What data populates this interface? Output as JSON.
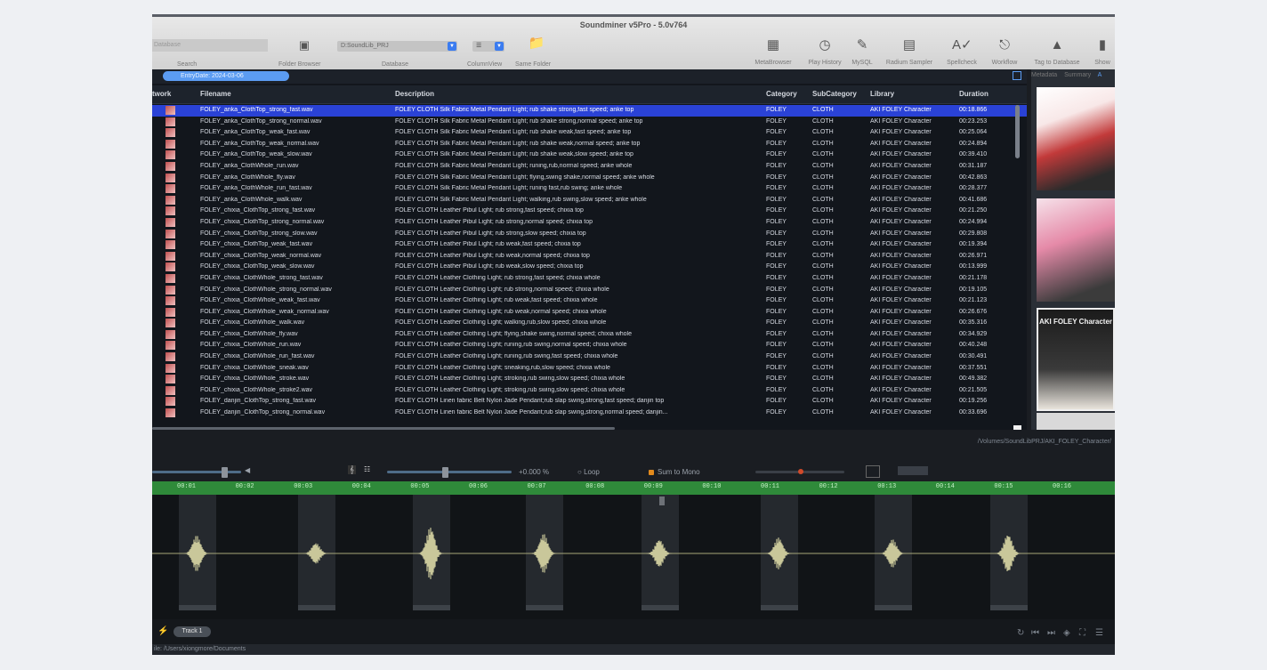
{
  "window": {
    "title": "Soundminer v5Pro - 5.0v764"
  },
  "toolbar": {
    "search_placeholder": "Database",
    "search_label": "Search",
    "folder_browser_label": "Folder Browser",
    "database_value": "D:SoundLib_PRJ",
    "database_label": "Database",
    "columnview_value": "☰",
    "columnview_label": "ColumnView",
    "same_folder_label": "Same Folder",
    "right_items": [
      {
        "label": "MetaBrowser",
        "icon": "metabrowser-icon"
      },
      {
        "label": "Play History",
        "icon": "clock-icon"
      },
      {
        "label": "MySQL",
        "icon": "database-icon"
      },
      {
        "label": "Radium Sampler",
        "icon": "sampler-icon"
      },
      {
        "label": "Spellcheck",
        "icon": "spellcheck-icon"
      },
      {
        "label": "Workflow",
        "icon": "workflow-icon"
      },
      {
        "label": "Tag to Database",
        "icon": "tag-icon"
      },
      {
        "label": "Show",
        "icon": "show-icon"
      }
    ]
  },
  "filter": {
    "pill": "EntryDate: 2024-03-06"
  },
  "table": {
    "headers": [
      "twork",
      "Filename",
      "Description",
      "Category",
      "SubCategory",
      "Library",
      "Duration"
    ],
    "selected_index": 0,
    "rows": [
      [
        "FOLEY_anka_ClothTop_strong_fast.wav",
        "FOLEY CLOTH Silk Fabric Metal Pendant Light; rub shake strong,fast speed; anke top",
        "FOLEY",
        "CLOTH",
        "AKI FOLEY Character",
        "00:18.866"
      ],
      [
        "FOLEY_anka_ClothTop_strong_normal.wav",
        "FOLEY CLOTH Silk Fabric Metal Pendant Light; rub shake strong,normal speed; anke top",
        "FOLEY",
        "CLOTH",
        "AKI FOLEY Character",
        "00:23.253"
      ],
      [
        "FOLEY_anka_ClothTop_weak_fast.wav",
        "FOLEY CLOTH Silk Fabric Metal Pendant Light; rub shake weak,fast speed; anke top",
        "FOLEY",
        "CLOTH",
        "AKI FOLEY Character",
        "00:25.064"
      ],
      [
        "FOLEY_anka_ClothTop_weak_normal.wav",
        "FOLEY CLOTH Silk Fabric Metal Pendant Light; rub shake weak,normal speed; anke top",
        "FOLEY",
        "CLOTH",
        "AKI FOLEY Character",
        "00:24.894"
      ],
      [
        "FOLEY_anka_ClothTop_weak_slow.wav",
        "FOLEY CLOTH Silk Fabric Metal Pendant Light; rub shake weak,slow speed; anke top",
        "FOLEY",
        "CLOTH",
        "AKI FOLEY Character",
        "00:39.410"
      ],
      [
        "FOLEY_anka_ClothWhole_run.wav",
        "FOLEY CLOTH Silk Fabric Metal Pendant Light; runing,rub,normal speed; anke whole",
        "FOLEY",
        "CLOTH",
        "AKI FOLEY Character",
        "00:31.187"
      ],
      [
        "FOLEY_anka_ClothWhole_fly.wav",
        "FOLEY CLOTH Silk Fabric Metal Pendant Light; flying,swing shake,normal speed; anke whole",
        "FOLEY",
        "CLOTH",
        "AKI FOLEY Character",
        "00:42.863"
      ],
      [
        "FOLEY_anka_ClothWhole_run_fast.wav",
        "FOLEY CLOTH Silk Fabric Metal Pendant Light; runing fast,rub swing; anke whole",
        "FOLEY",
        "CLOTH",
        "AKI FOLEY Character",
        "00:28.377"
      ],
      [
        "FOLEY_anka_ClothWhole_walk.wav",
        "FOLEY CLOTH Silk Fabric Metal Pendant Light; walking,rub swing,slow speed; anke whole",
        "FOLEY",
        "CLOTH",
        "AKI FOLEY Character",
        "00:41.686"
      ],
      [
        "FOLEY_chixia_ClothTop_strong_fast.wav",
        "FOLEY CLOTH Leather Pibul Light; rub strong,fast speed; chixia top",
        "FOLEY",
        "CLOTH",
        "AKI FOLEY Character",
        "00:21.250"
      ],
      [
        "FOLEY_chixia_ClothTop_strong_normal.wav",
        "FOLEY CLOTH Leather Pibul Light; rub strong,normal speed; chixia top",
        "FOLEY",
        "CLOTH",
        "AKI FOLEY Character",
        "00:24.994"
      ],
      [
        "FOLEY_chixia_ClothTop_strong_slow.wav",
        "FOLEY CLOTH Leather Pibul Light; rub strong,slow speed; chixia top",
        "FOLEY",
        "CLOTH",
        "AKI FOLEY Character",
        "00:29.808"
      ],
      [
        "FOLEY_chixia_ClothTop_weak_fast.wav",
        "FOLEY CLOTH Leather Pibul Light; rub weak,fast speed; chixia top",
        "FOLEY",
        "CLOTH",
        "AKI FOLEY Character",
        "00:19.394"
      ],
      [
        "FOLEY_chixia_ClothTop_weak_normal.wav",
        "FOLEY CLOTH Leather Pibul Light; rub weak,normal speed; chixia top",
        "FOLEY",
        "CLOTH",
        "AKI FOLEY Character",
        "00:26.971"
      ],
      [
        "FOLEY_chixia_ClothTop_weak_slow.wav",
        "FOLEY CLOTH Leather Pibul Light; rub weak,slow speed; chixia top",
        "FOLEY",
        "CLOTH",
        "AKI FOLEY Character",
        "00:13.999"
      ],
      [
        "FOLEY_chixia_ClothWhole_strong_fast.wav",
        "FOLEY CLOTH Leather Clothing Light; rub strong,fast speed; chixia whole",
        "FOLEY",
        "CLOTH",
        "AKI FOLEY Character",
        "00:21.178"
      ],
      [
        "FOLEY_chixia_ClothWhole_strong_normal.wav",
        "FOLEY CLOTH Leather Clothing Light; rub strong,normal speed; chixia whole",
        "FOLEY",
        "CLOTH",
        "AKI FOLEY Character",
        "00:19.105"
      ],
      [
        "FOLEY_chixia_ClothWhole_weak_fast.wav",
        "FOLEY CLOTH Leather Clothing Light; rub weak,fast speed; chixia whole",
        "FOLEY",
        "CLOTH",
        "AKI FOLEY Character",
        "00:21.123"
      ],
      [
        "FOLEY_chixia_ClothWhole_weak_normal.wav",
        "FOLEY CLOTH Leather Clothing Light; rub weak,normal speed; chixia whole",
        "FOLEY",
        "CLOTH",
        "AKI FOLEY Character",
        "00:26.676"
      ],
      [
        "FOLEY_chixia_ClothWhole_walk.wav",
        "FOLEY CLOTH Leather Clothing Light; walking,rub,slow speed; chixia whole",
        "FOLEY",
        "CLOTH",
        "AKI FOLEY Character",
        "00:35.316"
      ],
      [
        "FOLEY_chixia_ClothWhole_fly.wav",
        "FOLEY CLOTH Leather Clothing Light; flying,shake swing,normal speed; chixia whole",
        "FOLEY",
        "CLOTH",
        "AKI FOLEY Character",
        "00:34.929"
      ],
      [
        "FOLEY_chixia_ClothWhole_run.wav",
        "FOLEY CLOTH Leather Clothing Light; runing,rub swing,normal speed; chixia whole",
        "FOLEY",
        "CLOTH",
        "AKI FOLEY Character",
        "00:40.248"
      ],
      [
        "FOLEY_chixia_ClothWhole_run_fast.wav",
        "FOLEY CLOTH Leather Clothing Light; runing,rub swing,fast speed; chixia whole",
        "FOLEY",
        "CLOTH",
        "AKI FOLEY Character",
        "00:30.491"
      ],
      [
        "FOLEY_chixia_ClothWhole_sneak.wav",
        "FOLEY CLOTH Leather Clothing Light; sneaking,rub,slow speed; chixia whole",
        "FOLEY",
        "CLOTH",
        "AKI FOLEY Character",
        "00:37.551"
      ],
      [
        "FOLEY_chixia_ClothWhole_stroke.wav",
        "FOLEY CLOTH Leather Clothing Light; stroking,rub swing,slow speed; chixia whole",
        "FOLEY",
        "CLOTH",
        "AKI FOLEY Character",
        "00:49.382"
      ],
      [
        "FOLEY_chixia_ClothWhole_stroke2.wav",
        "FOLEY CLOTH Leather Clothing Light; stroking,rub swing,slow speed; chixia whole",
        "FOLEY",
        "CLOTH",
        "AKI FOLEY Character",
        "00:21.505"
      ],
      [
        "FOLEY_danjin_ClothTop_strong_fast.wav",
        "FOLEY CLOTH Linen fabric Belt Nylon Jade Pendant;rub slap swing,strong,fast speed; danjin top",
        "FOLEY",
        "CLOTH",
        "AKI FOLEY Character",
        "00:19.256"
      ],
      [
        "FOLEY_danjin_ClothTop_strong_normal.wav",
        "FOLEY CLOTH Linen fabric Belt Nylon Jade Pendant;rub slap swing,strong,normal speed; danjin...",
        "FOLEY",
        "CLOTH",
        "AKI FOLEY Character",
        "00:33.696"
      ]
    ]
  },
  "right_panel": {
    "tabs": [
      "Metadata",
      "Summary",
      "A"
    ],
    "thumb_logo": "AKI FOLEY Character"
  },
  "path": "/Volumes/SoundLibPRJ/AKI_FOLEY_Character/",
  "transport": {
    "offset": "+0.000 %",
    "loop": "Loop",
    "sum_to_mono": "Sum to Mono"
  },
  "ruler": [
    "00:01",
    "00:02",
    "00:03",
    "00:04",
    "00:05",
    "00:06",
    "00:07",
    "00:08",
    "00:09",
    "00:10",
    "00:11",
    "00:12",
    "00:13",
    "00:14",
    "00:15",
    "00:16"
  ],
  "waveform": {
    "events": 8
  },
  "track": {
    "label": "Track 1"
  },
  "status": {
    "path": "ile: /Users/xiongmore/Documents"
  }
}
